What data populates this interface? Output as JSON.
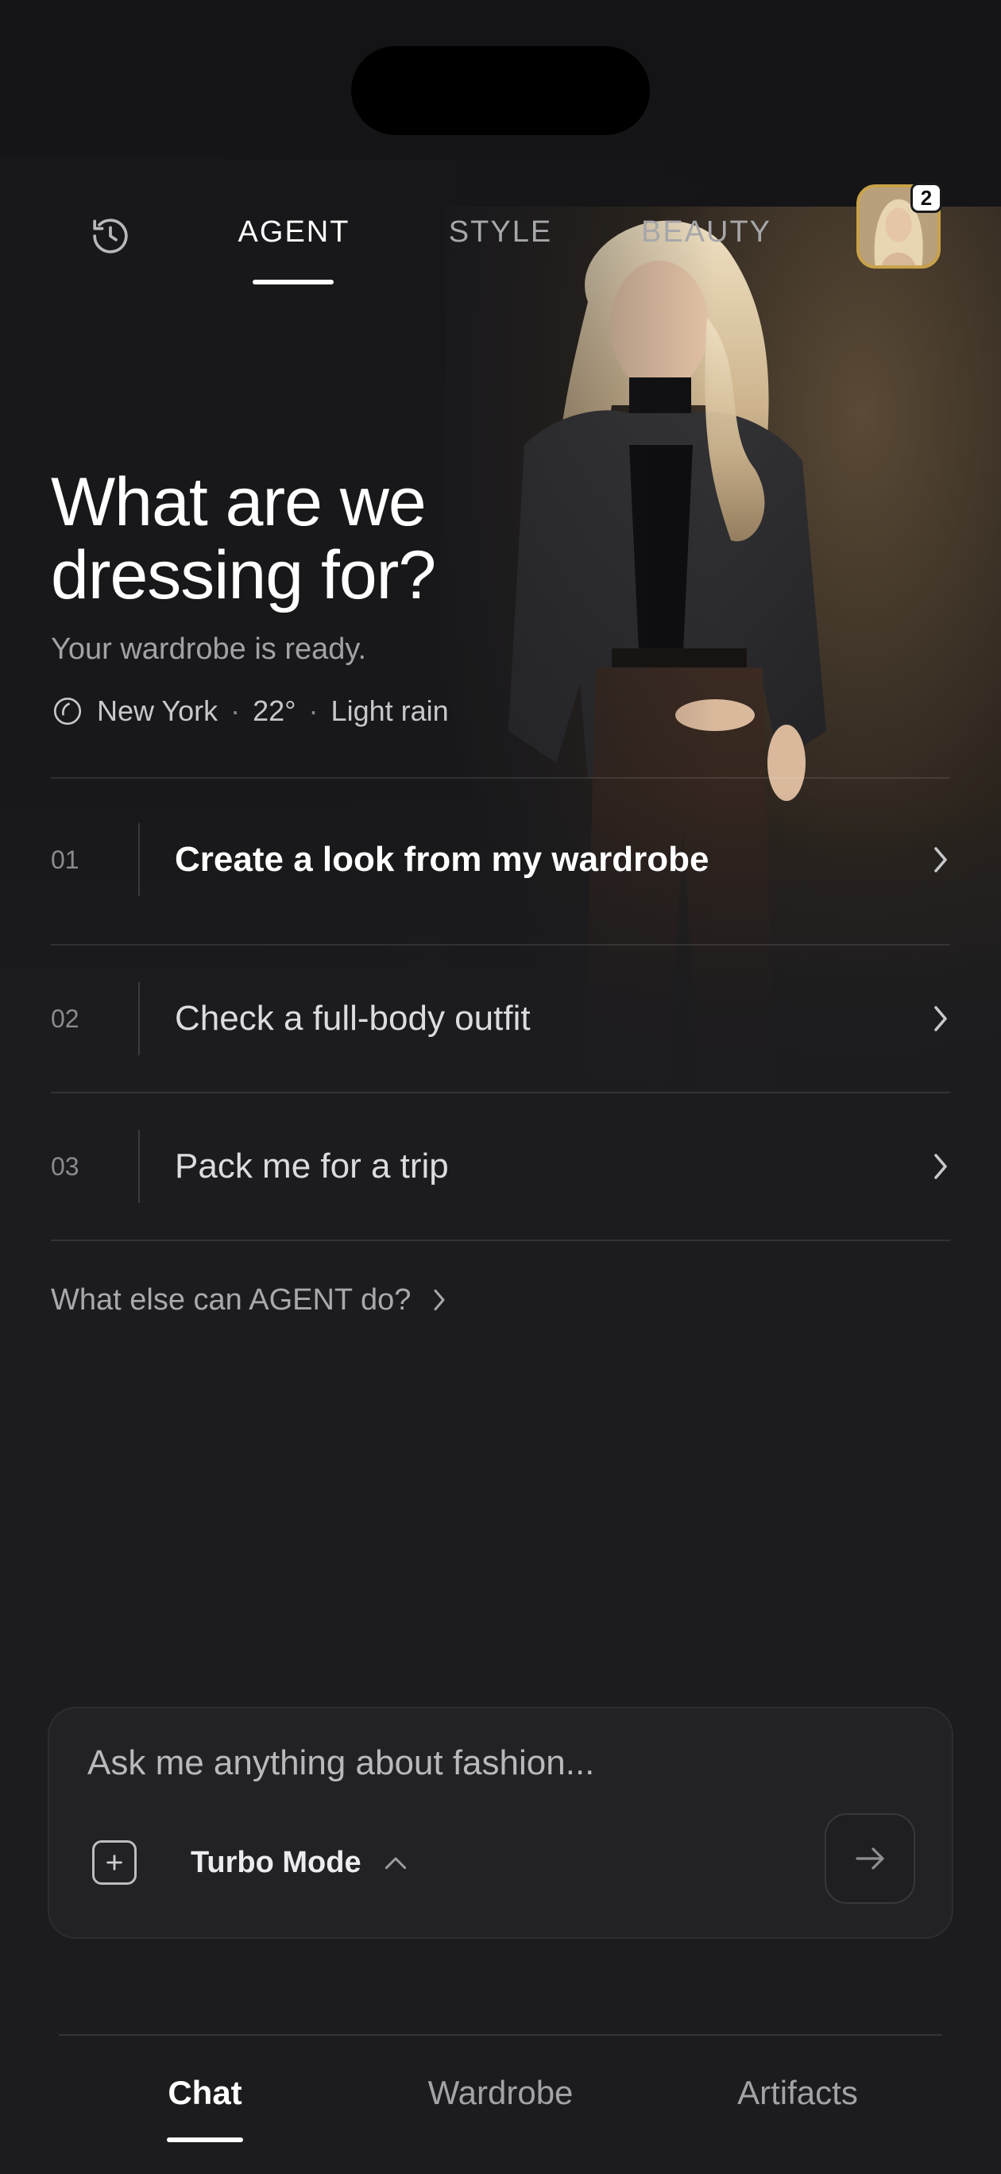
{
  "top_tabs": [
    {
      "label": "AGENT",
      "active": true
    },
    {
      "label": "STYLE",
      "active": false
    },
    {
      "label": "BEAUTY",
      "active": false
    }
  ],
  "avatar": {
    "badge_count": "2"
  },
  "hero": {
    "headline_line1": "What are we",
    "headline_line2": "dressing for?",
    "subline": "Your wardrobe is ready.",
    "weather": {
      "city": "New York",
      "temp": "22°",
      "condition": "Light rain",
      "separator": "·"
    }
  },
  "actions": [
    {
      "num": "01",
      "label": "Create a look from my wardrobe"
    },
    {
      "num": "02",
      "label": "Check a full-body outfit"
    },
    {
      "num": "03",
      "label": "Pack me for a trip"
    }
  ],
  "more_link": "What else can AGENT do?",
  "composer": {
    "placeholder": "Ask me anything about fashion...",
    "mode_label": "Turbo Mode"
  },
  "bottom_tabs": [
    {
      "label": "Chat",
      "active": true
    },
    {
      "label": "Wardrobe",
      "active": false
    },
    {
      "label": "Artifacts",
      "active": false
    }
  ],
  "icons": {
    "history": "history-icon",
    "weather": "rain-drop-icon",
    "chevron": "chevron-right-icon",
    "attach": "plus-square-icon",
    "mode_toggle": "chevron-up-icon",
    "send": "arrow-right-icon"
  },
  "colors": {
    "background": "#1b1b1d",
    "text_primary": "#ffffff",
    "text_secondary": "#a3a3a7",
    "avatar_border": "#c8a24a"
  }
}
